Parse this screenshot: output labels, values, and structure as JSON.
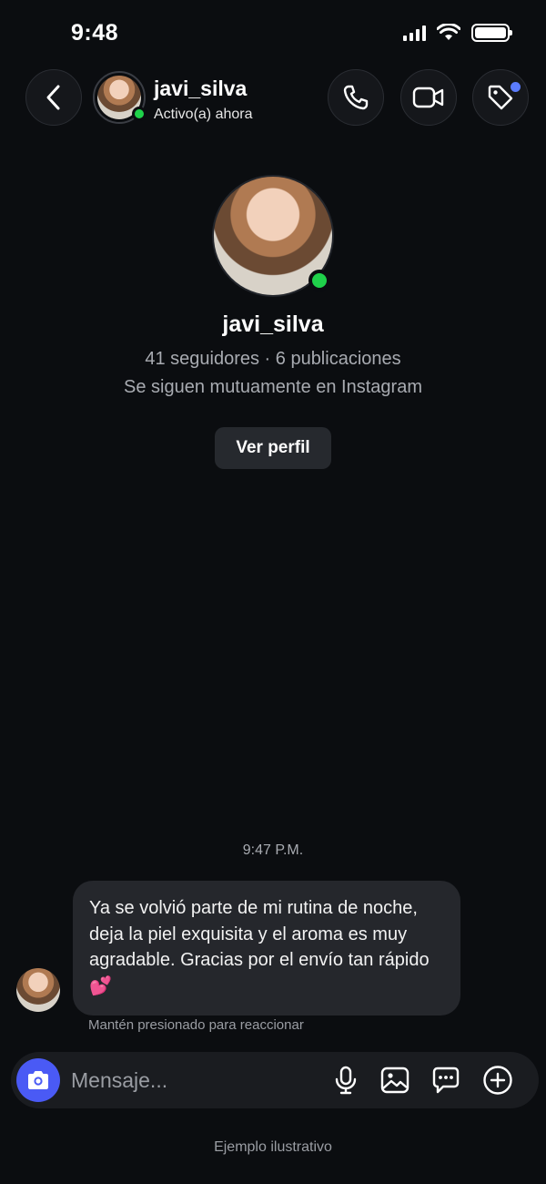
{
  "status_bar": {
    "time": "9:48"
  },
  "header": {
    "username": "javi_silva",
    "status": "Activo(a) ahora",
    "icons": [
      "chevron-left-icon",
      "phone-icon",
      "video-icon",
      "tag-icon"
    ]
  },
  "profile": {
    "username": "javi_silva",
    "stats": "41 seguidores · 6 publicaciones",
    "mutual": "Se siguen mutuamente en Instagram",
    "view_profile_label": "Ver perfil"
  },
  "conversation": {
    "timestamp": "9:47 P.M.",
    "message": "Ya se volvió parte de mi rutina de noche, deja la piel exquisita y el aroma es muy agradable. Gracias por el envío tan rápido 💕",
    "hint": "Mantén presionado para reaccionar"
  },
  "composer": {
    "placeholder": "Mensaje...",
    "icons": [
      "camera-icon",
      "microphone-icon",
      "gallery-icon",
      "sticker-icon",
      "plus-icon"
    ]
  },
  "footer_note": "Ejemplo ilustrativo",
  "colors": {
    "online": "#1fd14a",
    "camera_button": "#4a5af5",
    "notification_dot": "#5b7cff",
    "background": "#0b0d10"
  }
}
